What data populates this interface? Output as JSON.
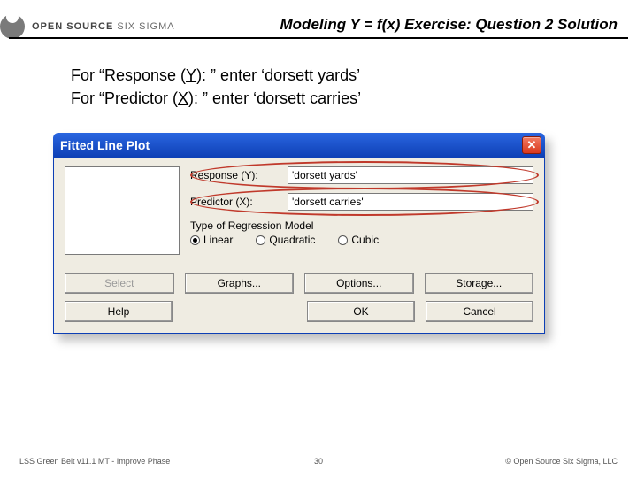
{
  "header": {
    "brand_bold": "OPEN SOURCE",
    "brand_light": "SIX SIGMA",
    "title": "Modeling Y = f(x) Exercise: Question 2 Solution"
  },
  "instructions": {
    "line1_a": "For “Response (",
    "line1_y": "Y",
    "line1_b": "): ” enter ‘dorsett yards’",
    "line2_a": "For “Predictor (",
    "line2_x": "X",
    "line2_b": "): ” enter ‘dorsett carries’"
  },
  "dialog": {
    "title": "Fitted Line Plot",
    "close_glyph": "✕",
    "response_label": "Response (Y):",
    "response_value": "'dorsett yards'",
    "predictor_label": "Predictor (X):",
    "predictor_value": "'dorsett carries'",
    "regression_label": "Type of Regression Model",
    "radios": {
      "linear": "Linear",
      "quadratic": "Quadratic",
      "cubic": "Cubic",
      "selected": "linear"
    },
    "buttons": {
      "select": "Select",
      "graphs": "Graphs...",
      "options": "Options...",
      "storage": "Storage...",
      "help": "Help",
      "ok": "OK",
      "cancel": "Cancel"
    }
  },
  "footer": {
    "left": "LSS Green Belt v11.1 MT - Improve Phase",
    "center": "30",
    "right": "© Open Source Six Sigma, LLC"
  }
}
